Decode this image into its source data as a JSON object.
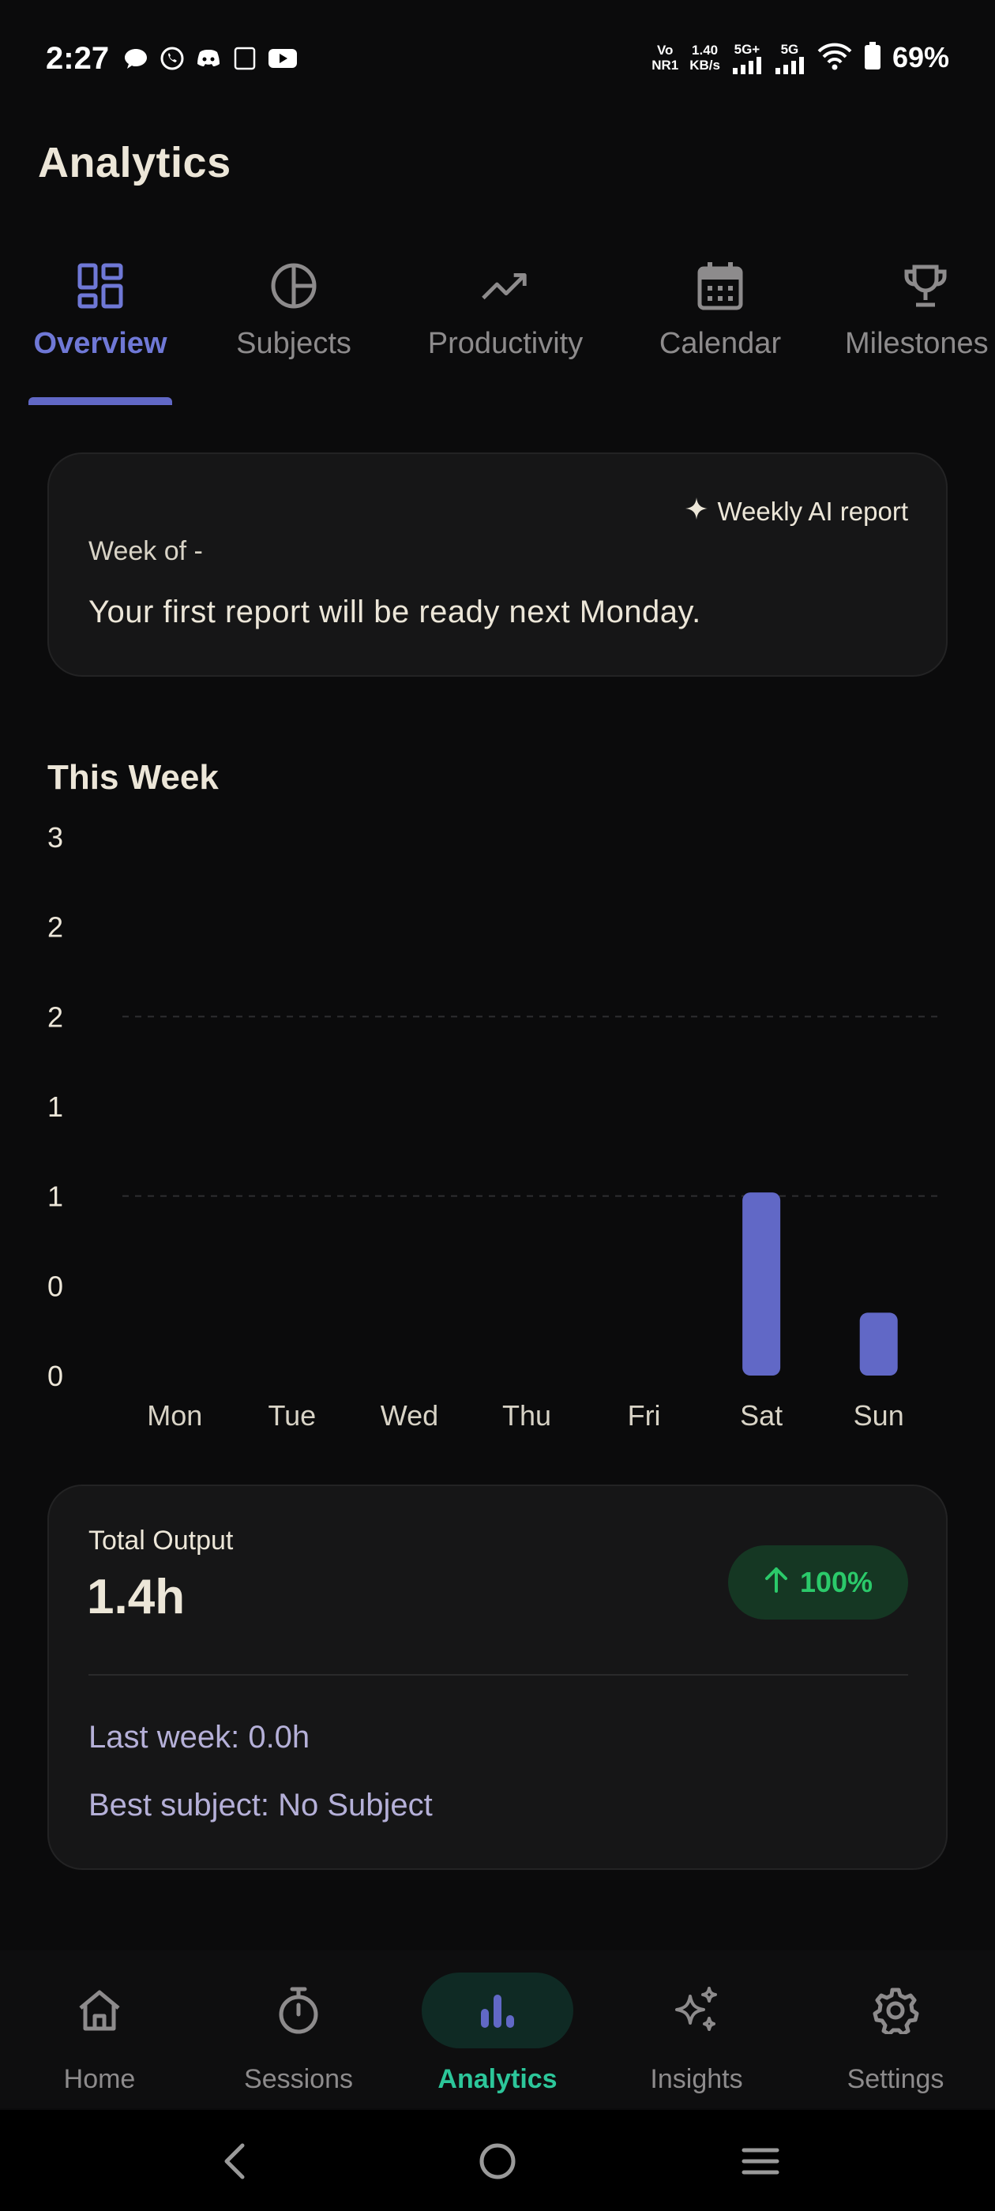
{
  "status_bar": {
    "time": "2:27",
    "network_label_1": "Vo",
    "network_label_2": "NR1",
    "speed_value": "1.40",
    "speed_unit": "KB/s",
    "signal_1_label": "5G+",
    "signal_2_label": "5G",
    "battery_percent": "69%"
  },
  "header": {
    "title": "Analytics"
  },
  "tabs": [
    {
      "label": "Overview",
      "icon": "dashboard-icon",
      "active": true
    },
    {
      "label": "Subjects",
      "icon": "pie-chart-icon",
      "active": false
    },
    {
      "label": "Productivity",
      "icon": "trending-up-icon",
      "active": false
    },
    {
      "label": "Calendar",
      "icon": "calendar-icon",
      "active": false
    },
    {
      "label": "Milestones",
      "icon": "trophy-icon",
      "active": false
    }
  ],
  "report": {
    "badge": "Weekly AI report",
    "week": "Week of -",
    "message": "Your first report will be ready next Monday."
  },
  "chart_data": {
    "type": "bar",
    "title": "This Week",
    "categories": [
      "Mon",
      "Tue",
      "Wed",
      "Thu",
      "Fri",
      "Sat",
      "Sun"
    ],
    "values": [
      0,
      0,
      0,
      0,
      0,
      1.02,
      0.35
    ],
    "y_tick_labels": [
      "3",
      "2",
      "2",
      "1",
      "1",
      "0",
      "0"
    ],
    "ylim": [
      0,
      3
    ],
    "grid": "dashed horizontal at 1 and 2",
    "bar_color": "#6168c6"
  },
  "output": {
    "label": "Total Output",
    "value": "1.4h",
    "change": "100%",
    "last_week": "Last week: 0.0h",
    "best_subject": "Best subject: No Subject"
  },
  "bottom_nav": [
    {
      "label": "Home",
      "icon": "home-icon",
      "active": false
    },
    {
      "label": "Sessions",
      "icon": "stopwatch-icon",
      "active": false
    },
    {
      "label": "Analytics",
      "icon": "bar-chart-icon",
      "active": true
    },
    {
      "label": "Insights",
      "icon": "sparkles-icon",
      "active": false
    },
    {
      "label": "Settings",
      "icon": "gear-icon",
      "active": false
    }
  ],
  "colors": {
    "background": "#0b0b0c",
    "accent": "#6168c6",
    "active_nav": "#2cc69a",
    "positive": "#2bc96a"
  }
}
